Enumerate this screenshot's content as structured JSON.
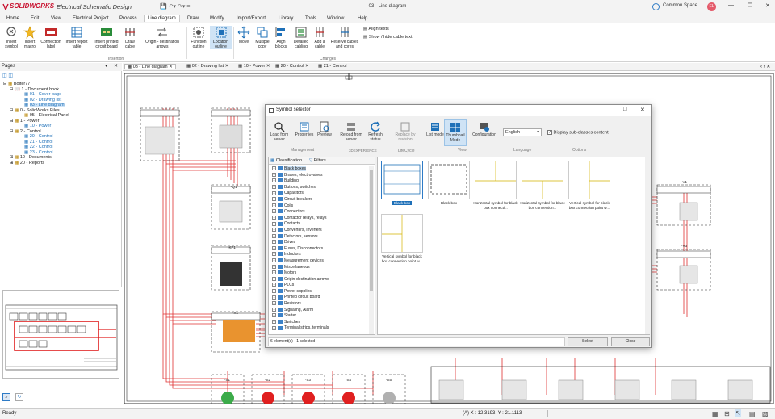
{
  "titlebar": {
    "brand": "SOLIDWORKS",
    "app": "Electrical Schematic Design",
    "document": "03 - Line diagram",
    "workspace": "Common Space",
    "avatar_initials": "EL"
  },
  "menu": [
    "Home",
    "Edit",
    "View",
    "Electrical Project",
    "Process",
    "Line diagram",
    "Draw",
    "Modify",
    "Import/Export",
    "Library",
    "Tools",
    "Window",
    "Help"
  ],
  "ribbon": {
    "buttons": [
      {
        "label": "Insert symbol",
        "arrow": true
      },
      {
        "label": "Insert macro"
      },
      {
        "label": "Connection label",
        "arrow": true
      },
      {
        "label": "Insert report table"
      },
      {
        "label": "Insert printed circuit board"
      },
      {
        "label": "Draw cable"
      },
      {
        "label": "Origin - destination arrows",
        "arrow": true
      },
      {
        "label": "Function outline",
        "arrow": true
      },
      {
        "label": "Location outline",
        "arrow": true
      },
      {
        "label": "Move"
      },
      {
        "label": "Multiple copy"
      },
      {
        "label": "Align blocks"
      },
      {
        "label": "Detailed cabling"
      },
      {
        "label": "Add a cable"
      },
      {
        "label": "Reserve cables and cores"
      }
    ],
    "small_buttons": [
      "Align texts",
      "Show / hide cable text"
    ],
    "groups": [
      "Insertion",
      "Changes"
    ]
  },
  "pages_panel": {
    "title": "Pages",
    "tree": [
      {
        "label": "Bolter77",
        "level": 0
      },
      {
        "label": "1 - Document book",
        "level": 1
      },
      {
        "label": "01 - Cover page",
        "level": 2
      },
      {
        "label": "02 - Drawing list",
        "level": 2
      },
      {
        "label": "03 - Line diagram",
        "level": 2,
        "selected": true
      },
      {
        "label": "0 - SolidWorks Files",
        "level": 1
      },
      {
        "label": "05 - Electrical Panel",
        "level": 2
      },
      {
        "label": "1 - Power",
        "level": 1
      },
      {
        "label": "10 - Power",
        "level": 2
      },
      {
        "label": "2 - Control",
        "level": 1
      },
      {
        "label": "20 - Control",
        "level": 2
      },
      {
        "label": "21 - Control",
        "level": 2
      },
      {
        "label": "22 - Control",
        "level": 2
      },
      {
        "label": "23 - Control",
        "level": 2
      },
      {
        "label": "10 - Documents",
        "level": 1
      },
      {
        "label": "20 - Reports",
        "level": 1
      }
    ]
  },
  "doc_tabs": [
    "03 - Line diagram",
    "02 - Drawing list",
    "10 - Power",
    "20 - Control",
    "21 - Control"
  ],
  "dialog": {
    "title": "Symbol selector",
    "toolbar": [
      {
        "label": "Load from server",
        "group": "Management"
      },
      {
        "label": "Properties",
        "group": "Management"
      },
      {
        "label": "Preview",
        "group": "Management"
      },
      {
        "label": "Reload from server",
        "group": "3DEXPERIENCE"
      },
      {
        "label": "Refresh status",
        "group": "3DEXPERIENCE"
      },
      {
        "label": "Replace by revision",
        "group": "Lifecycle"
      },
      {
        "label": "List mode",
        "group": "View"
      },
      {
        "label": "Thumbnail Mode",
        "group": "View",
        "active": true
      },
      {
        "label": "Configuration",
        "group": ""
      }
    ],
    "groups": [
      "Management",
      "3DEXPERIENCE",
      "LifeCycle",
      "View",
      "Language",
      "Options"
    ],
    "language": "English",
    "display_subclasses_label": "Display sub-classes content",
    "display_subclasses_checked": true,
    "tabs": [
      "Classification",
      "Filters"
    ],
    "classifications": [
      "Black boxes",
      "Brakes, electrovalves",
      "Building",
      "Buttons, switches",
      "Capacitors",
      "Circuit breakers",
      "Coils",
      "Connectors",
      "Contactor relays, relays",
      "Contacts",
      "Converters, Inverters",
      "Detectors, sensors",
      "Drives",
      "Fuses, Disconnectors",
      "Inductors",
      "Measurement devices",
      "Miscellaneous",
      "Motors",
      "Origin-destination arrows",
      "PLCs",
      "Power supplies",
      "Printed circuit board",
      "Resistors",
      "Signaling, Alarm",
      "Starter",
      "Switches",
      "Terminal strips, terminals"
    ],
    "symbols": [
      {
        "caption": "Black box",
        "selected": true
      },
      {
        "caption": "Black box"
      },
      {
        "caption": "Horizontal symbol for black box connecti..."
      },
      {
        "caption": "Horizontal symbol for black box connection..."
      },
      {
        "caption": "Vertical symbol for black box connection point w..."
      },
      {
        "caption": "Vertical symbol for black box connection point w..."
      }
    ],
    "status": "6 element(s) - 1 selected",
    "select_label": "Select",
    "close_label": "Close"
  },
  "canvas_labels": [
    "-S1",
    "-S2",
    "-S3",
    "-S4",
    "-S5",
    "-S5",
    "-Q1",
    "-Q2",
    "-Q3",
    "-KF1",
    "-KF2",
    "-V1",
    "-V2",
    "-V3",
    "-X1"
  ],
  "status_bar": {
    "left": "Ready",
    "coords": "(A) X : 12.3193, Y : 21.1113"
  },
  "colors": {
    "brand_red": "#c8102e",
    "wire_red": "#e03030",
    "selection_blue": "#cde3f7",
    "ribbon_active": "#cfe3f5"
  }
}
